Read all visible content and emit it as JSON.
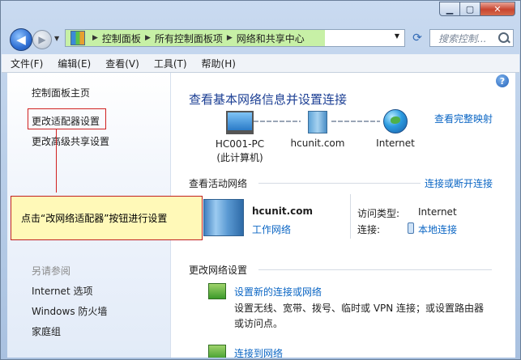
{
  "nav": {
    "breadcrumbs": [
      "控制面板",
      "所有控制面板项",
      "网络和共享中心"
    ],
    "search_placeholder": "搜索控制..."
  },
  "menu": [
    "文件(F)",
    "编辑(E)",
    "查看(V)",
    "工具(T)",
    "帮助(H)"
  ],
  "sidebar": {
    "links": [
      "控制面板主页",
      "更改适配器设置",
      "更改高级共享设置"
    ],
    "see_also_title": "另请参阅",
    "see_also": [
      "Internet 选项",
      "Windows 防火墙",
      "家庭组"
    ]
  },
  "annotation": {
    "callout_text": "点击“改网络适配器”按钮进行设置",
    "border_color": "#d02020"
  },
  "main": {
    "title": "查看基本网络信息并设置连接",
    "full_map_link": "查看完整映射",
    "map_nodes": [
      {
        "line1": "HC001-PC",
        "line2": "(此计算机)"
      },
      {
        "line1": "hcunit.com",
        "line2": ""
      },
      {
        "line1": "Internet",
        "line2": ""
      }
    ],
    "active_networks_head": "查看活动网络",
    "connect_disconnect_link": "连接或断开连接",
    "active_network": {
      "name": "hcunit.com",
      "type": "工作网络",
      "access_type_label": "访问类型:",
      "access_type_value": "Internet",
      "connection_label": "连接:",
      "connection_value": "本地连接"
    },
    "change_settings_head": "更改网络设置",
    "tasks": [
      {
        "link": "设置新的连接或网络",
        "desc": "设置无线、宽带、拨号、临时或 VPN 连接；或设置路由器或访问点。"
      },
      {
        "link": "连接到网络",
        "desc": ""
      }
    ]
  },
  "colors": {
    "link": "#0b66c4",
    "title": "#1c3f94",
    "address_highlight": "#c7f0a6",
    "callout_bg": "#fff9b8"
  }
}
